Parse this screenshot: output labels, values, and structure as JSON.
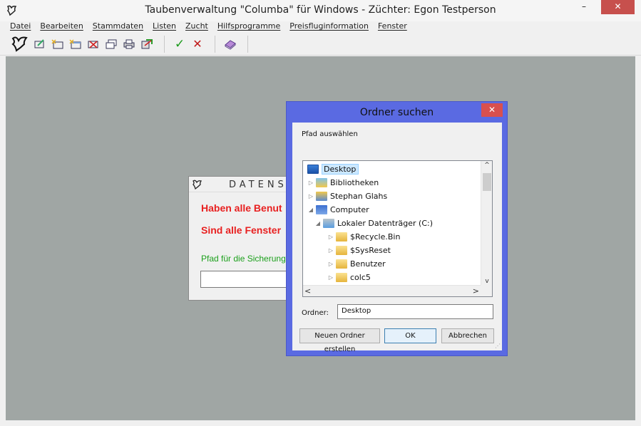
{
  "window": {
    "title": "Taubenverwaltung \"Columba\" für Windows  -  Züchter: Egon Testperson",
    "controls": {
      "minimize": "–",
      "maximize": "▫",
      "close": "✕"
    }
  },
  "menu": [
    "Datei",
    "Bearbeiten",
    "Stammdaten",
    "Listen",
    "Zucht",
    "Hilfsprogramme",
    "Preisfluginformation",
    "Fenster"
  ],
  "toolbar": {
    "icons": [
      "columba-logo-icon",
      "edit-icon",
      "new-record-icon",
      "new-window-icon",
      "delete-icon",
      "copy-icon",
      "print-icon",
      "export-icon",
      "confirm-icon",
      "cancel-icon",
      "book-icon"
    ],
    "confirm_glyph": "✓",
    "cancel_glyph": "✕"
  },
  "backup_dialog": {
    "title": "DATENSI",
    "question1": "Haben alle Benut",
    "question2": "Sind alle Fenster",
    "path_label": "Pfad für die Sicherung"
  },
  "folder_dialog": {
    "title": "Ordner suchen",
    "close_glyph": "✕",
    "instruction": "Pfad auswählen",
    "tree": [
      {
        "label": "Desktop",
        "expander": "",
        "icon": "desktop-icon",
        "selected": true
      },
      {
        "label": "Bibliotheken",
        "expander": "▷",
        "icon": "libraries-icon"
      },
      {
        "label": "Stephan Glahs",
        "expander": "▷",
        "icon": "user-folder-icon"
      },
      {
        "label": "Computer",
        "expander": "◢",
        "icon": "computer-icon"
      },
      {
        "label": "Lokaler Datenträger (C:)",
        "expander": "◢",
        "icon": "drive-icon"
      },
      {
        "label": "$Recycle.Bin",
        "expander": "▷",
        "icon": "folder-icon"
      },
      {
        "label": "$SysReset",
        "expander": "▷",
        "icon": "folder-icon"
      },
      {
        "label": "Benutzer",
        "expander": "▷",
        "icon": "folder-icon"
      },
      {
        "label": "colc5",
        "expander": "▷",
        "icon": "folder-icon"
      }
    ],
    "scroll": {
      "up": "^",
      "down": "v",
      "left": "<",
      "right": ">"
    },
    "folder_label": "Ordner:",
    "folder_value": "Desktop",
    "buttons": {
      "new_folder": "Neuen Ordner erstellen",
      "ok": "OK",
      "cancel": "Abbrechen"
    }
  }
}
